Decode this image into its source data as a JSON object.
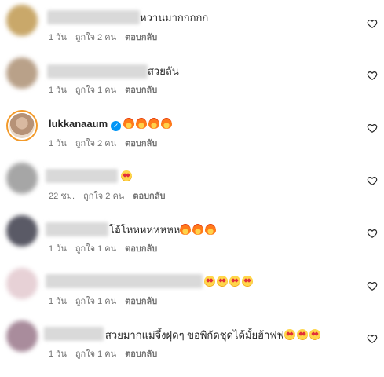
{
  "comments": [
    {
      "text": "หวานมากกกกก",
      "time": "1 วัน",
      "likes": "ถูกใจ 2 คน",
      "reply": "ตอบกลับ",
      "avatar_color": "#c9a86a"
    },
    {
      "text": "สวยลัน",
      "time": "1 วัน",
      "likes": "ถูกใจ 1 คน",
      "reply": "ตอบกลับ",
      "avatar_color": "#b9a189"
    },
    {
      "username": "lukkanaaum",
      "verified": true,
      "text": "",
      "emojis": [
        "fire",
        "fire",
        "fire",
        "fire"
      ],
      "time": "1 วัน",
      "likes": "ถูกใจ 2 คน",
      "reply": "ตอบกลับ"
    },
    {
      "text": "",
      "emojis": [
        "star-struck"
      ],
      "time": "22 ชม.",
      "likes": "ถูกใจ 2 คน",
      "reply": "ตอบกลับ",
      "avatar_color": "#a6a6a6"
    },
    {
      "text": "โอ้โหหหหหหหห",
      "emojis": [
        "fire",
        "fire",
        "fire"
      ],
      "time": "1 วัน",
      "likes": "ถูกใจ 1 คน",
      "reply": "ตอบกลับ",
      "avatar_color": "#5a5a66"
    },
    {
      "text": "",
      "emojis": [
        "star-struck",
        "star-struck",
        "star-struck",
        "star-struck"
      ],
      "time": "1 วัน",
      "likes": "ถูกใจ 1 คน",
      "reply": "ตอบกลับ",
      "avatar_color": "#e7d1d6"
    },
    {
      "text": "สวยมากแม่จึ้งฝุดๆ ขอพิกัดชุดได้มั้ยฮ้าฟฟ",
      "emojis": [
        "star-struck",
        "star-struck",
        "star-struck"
      ],
      "time": "1 วัน",
      "likes": "ถูกใจ 1 คน",
      "reply": "ตอบกลับ",
      "avatar_color": "#a98c9c"
    }
  ],
  "icons": {
    "like": "heart-outline-icon",
    "verified": "verified-badge-icon"
  },
  "colors": {
    "meta": "#737373",
    "text": "#262626",
    "verified": "#0095f6"
  }
}
